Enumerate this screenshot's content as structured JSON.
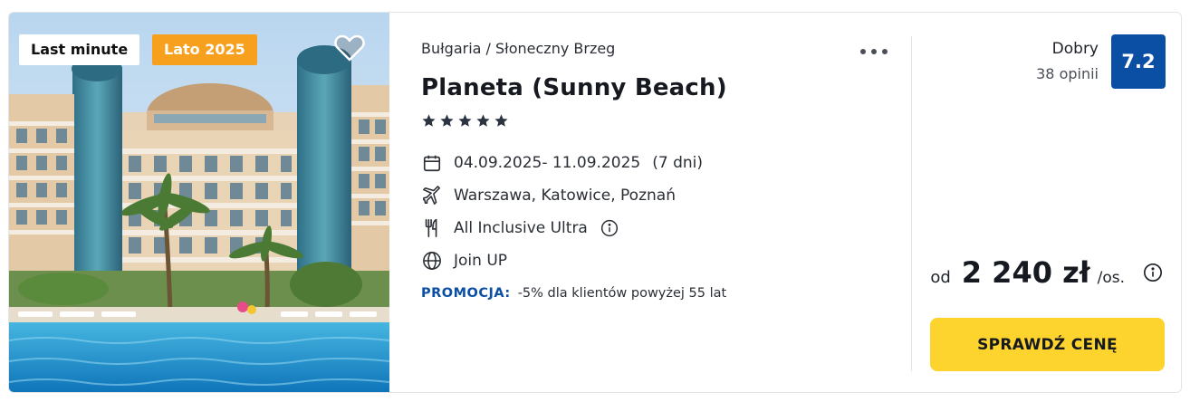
{
  "photo": {
    "badges": [
      "Last minute",
      "Lato 2025"
    ],
    "favorite_icon": "heart-outline-icon"
  },
  "hotel": {
    "location": "Bułgaria / Słoneczny Brzeg",
    "name": "Planeta (Sunny Beach)",
    "star_rating": 5,
    "more_icon": "more-dots-icon"
  },
  "trip": {
    "dates": "04.09.2025- 11.09.2025",
    "duration": "(7 dni)",
    "departure": "Warszawa, Katowice, Poznań",
    "board": "All Inclusive Ultra",
    "operator": "Join UP"
  },
  "promo": {
    "label": "PROMOCJA:",
    "text": "-5% dla klientów powyżej 55 lat"
  },
  "rating": {
    "label": "Dobry",
    "reviews": "38 opinii",
    "score": "7.2"
  },
  "price": {
    "prefix": "od",
    "value": "2 240 zł",
    "unit": "/os."
  },
  "cta": {
    "label": "SPRAWDŹ CENĘ"
  },
  "colors": {
    "accent_blue": "#0b4fa5",
    "cta_yellow": "#fdd32d",
    "season_badge": "#f6a01d"
  }
}
